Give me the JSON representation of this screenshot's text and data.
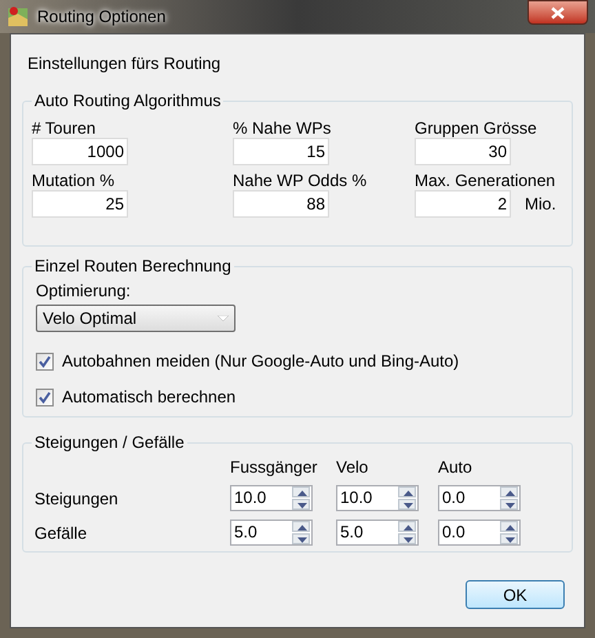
{
  "window": {
    "title": "Routing Optionen"
  },
  "heading": "Einstellungen fürs Routing",
  "auto_routing": {
    "title": "Auto Routing Algorithmus",
    "fields": [
      {
        "label": "# Touren",
        "value": "1000"
      },
      {
        "label": "% Nahe WPs",
        "value": "15"
      },
      {
        "label": "Gruppen Grösse",
        "value": "30"
      },
      {
        "label": "Mutation %",
        "value": "25"
      },
      {
        "label": "Nahe WP Odds %",
        "value": "88"
      },
      {
        "label": "Max. Generationen",
        "value": "2",
        "unit": "Mio."
      }
    ]
  },
  "single_route": {
    "title": "Einzel Routen Berechnung",
    "optimization_label": "Optimierung:",
    "optimization_value": "Velo Optimal",
    "checkboxes": [
      {
        "label": "Autobahnen meiden (Nur Google-Auto und Bing-Auto)",
        "checked": true
      },
      {
        "label": "Automatisch berechnen",
        "checked": true
      }
    ]
  },
  "gradients": {
    "title": "Steigungen / Gefälle",
    "columns": [
      "Fussgänger",
      "Velo",
      "Auto"
    ],
    "rows": [
      {
        "label": "Steigungen",
        "values": [
          "10.0",
          "10.0",
          "0.0"
        ]
      },
      {
        "label": "Gefälle",
        "values": [
          "5.0",
          "5.0",
          "0.0"
        ]
      }
    ]
  },
  "buttons": [
    "OK"
  ]
}
